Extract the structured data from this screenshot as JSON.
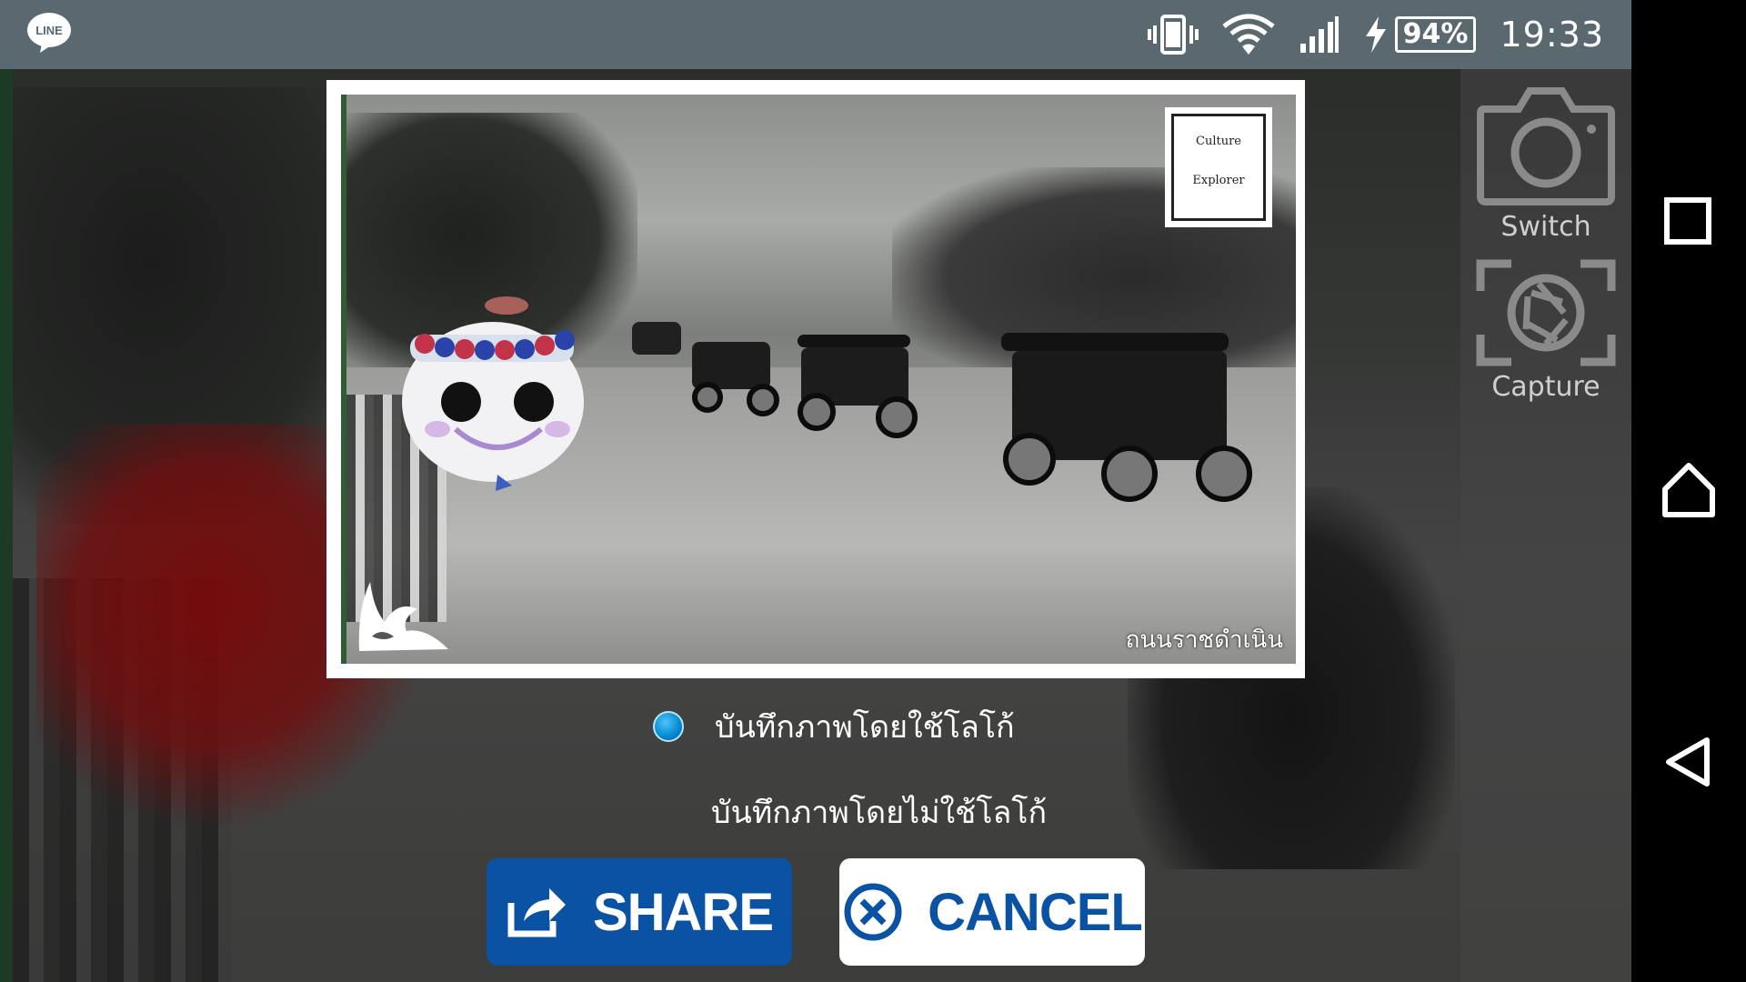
{
  "status_bar": {
    "app_icon_text": "LINE",
    "battery_percent": "94%",
    "time": "19:33"
  },
  "side_controls": {
    "switch_label": "Switch",
    "capture_label": "Capture"
  },
  "photo": {
    "stamp_top_text": "Culture",
    "stamp_bottom_text": "Explorer",
    "caption": "ถนนราชดำเนิน"
  },
  "options": [
    {
      "label": "บันทึกภาพโดยใช้โลโก้",
      "selected": true
    },
    {
      "label": "บันทึกภาพโดยไม่ใช้โลโก้",
      "selected": false
    }
  ],
  "buttons": {
    "share_label": "SHARE",
    "cancel_label": "CANCEL"
  },
  "colors": {
    "status_bar": "#5a6870",
    "accent_blue": "#0a52a3",
    "radio_blue": "#0288d1"
  },
  "icons": {
    "status": [
      "line-app-icon",
      "vibrate-icon",
      "wifi-icon",
      "signal-icon",
      "charging-icon",
      "battery-icon"
    ],
    "side": [
      "camera-switch-icon",
      "capture-icon"
    ],
    "nav": [
      "recent-apps-icon",
      "home-icon",
      "back-icon"
    ],
    "buttons": [
      "share-icon",
      "cancel-x-icon"
    ]
  }
}
